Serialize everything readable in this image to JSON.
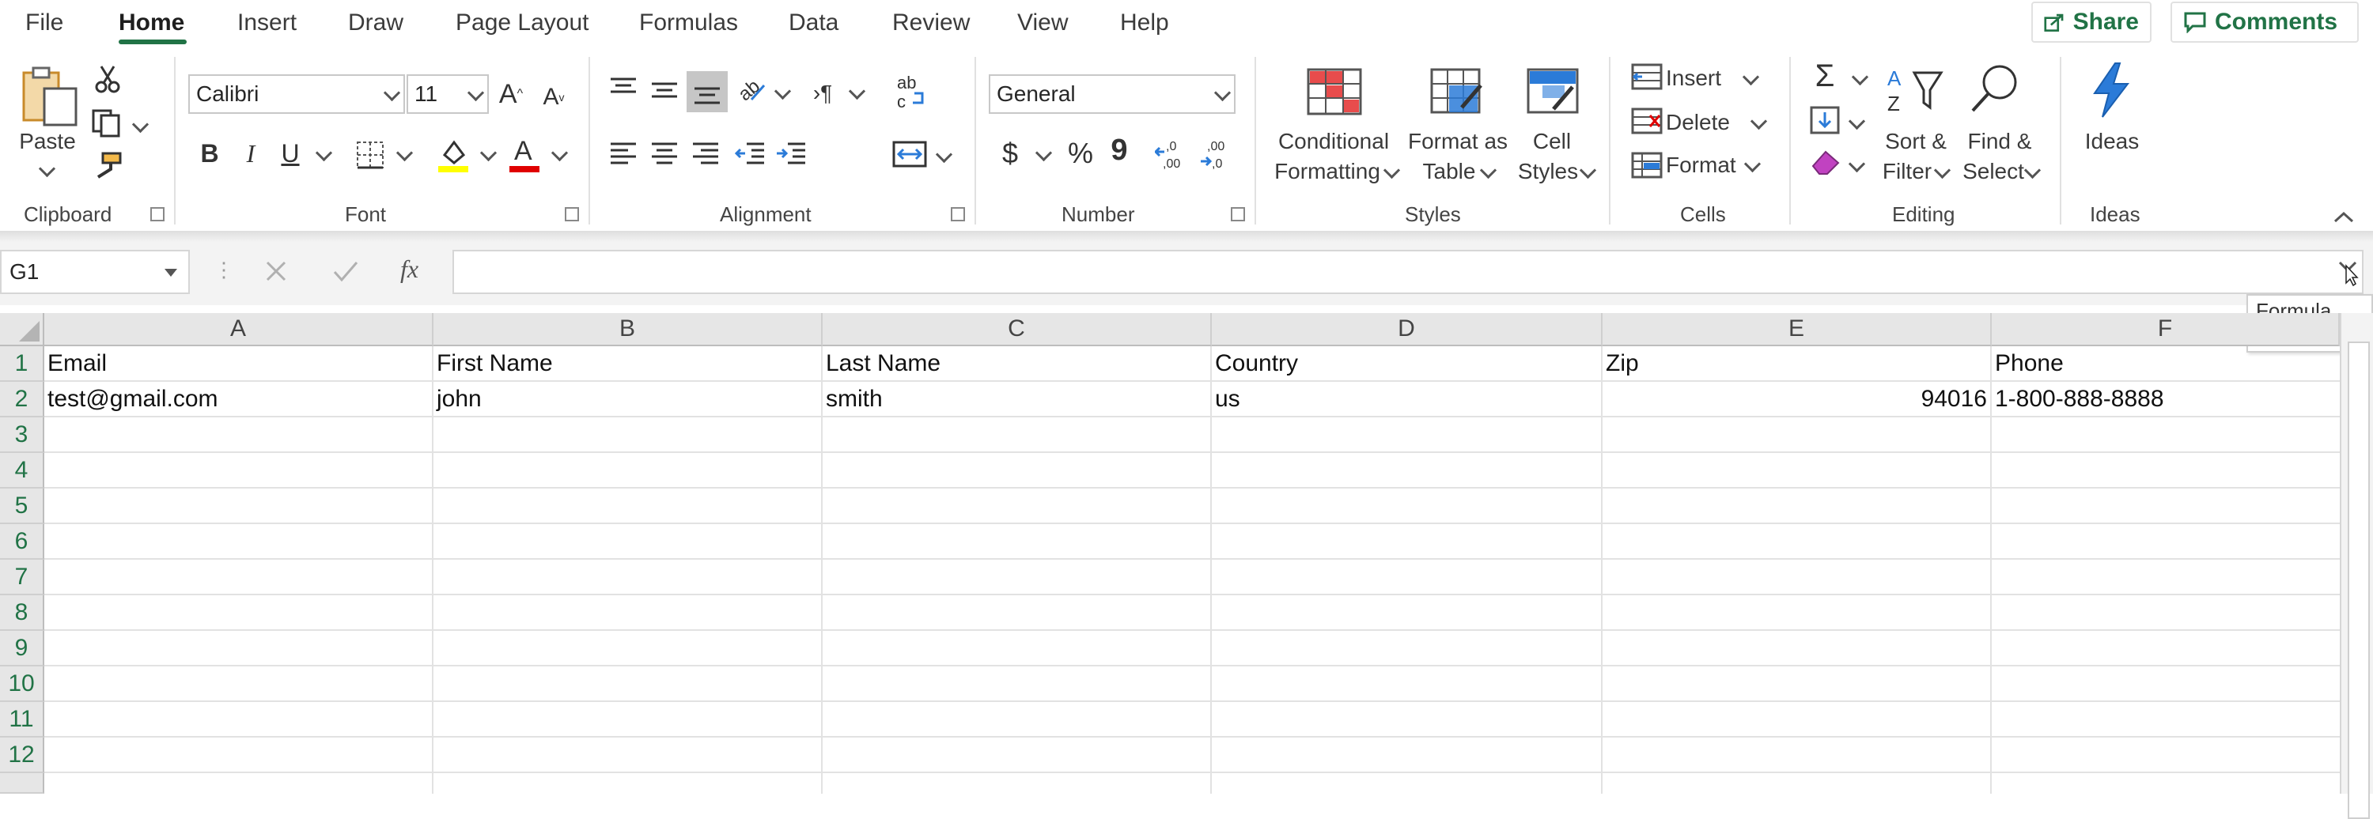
{
  "menu": {
    "tabs": [
      "File",
      "Home",
      "Insert",
      "Draw",
      "Page Layout",
      "Formulas",
      "Data",
      "Review",
      "View",
      "Help"
    ],
    "active_tab": "Home",
    "share_label": "Share",
    "comments_label": "Comments"
  },
  "ribbon": {
    "clipboard": {
      "label": "Clipboard",
      "paste": "Paste"
    },
    "font": {
      "label": "Font",
      "name": "Calibri",
      "size": "11",
      "bold": "B",
      "italic": "I",
      "underline": "U"
    },
    "alignment": {
      "label": "Alignment"
    },
    "number": {
      "label": "Number",
      "format": "General",
      "currency": "$",
      "percent": "%",
      "comma": "9"
    },
    "styles": {
      "label": "Styles",
      "cond_line1": "Conditional",
      "cond_line2": "Formatting",
      "table_line1": "Format as",
      "table_line2": "Table",
      "cell_line1": "Cell",
      "cell_line2": "Styles"
    },
    "cells": {
      "label": "Cells",
      "insert": "Insert",
      "delete": "Delete",
      "format": "Format"
    },
    "editing": {
      "label": "Editing",
      "sort_line1": "Sort &",
      "sort_line2": "Filter",
      "find_line1": "Find &",
      "find_line2": "Select"
    },
    "ideas": {
      "label": "Ideas",
      "button": "Ideas"
    }
  },
  "formula_bar": {
    "name_box": "G1",
    "fx": "fx",
    "value": "",
    "tooltip": "Formula Bar"
  },
  "grid": {
    "columns": [
      "A",
      "B",
      "C",
      "D",
      "E",
      "F"
    ],
    "rows": [
      "1",
      "2",
      "3",
      "4",
      "5",
      "6",
      "7",
      "8",
      "9",
      "10",
      "11",
      "12"
    ],
    "cells": {
      "r1": [
        "Email",
        "First Name",
        "Last Name",
        "Country",
        "Zip",
        "Phone"
      ],
      "r2": [
        "test@gmail.com",
        "john",
        "smith",
        "us",
        "94016",
        "1-800-888-8888"
      ]
    }
  },
  "colors": {
    "accent": "#217346",
    "font_highlight": "#ffff00",
    "font_color": "#ff0000"
  }
}
